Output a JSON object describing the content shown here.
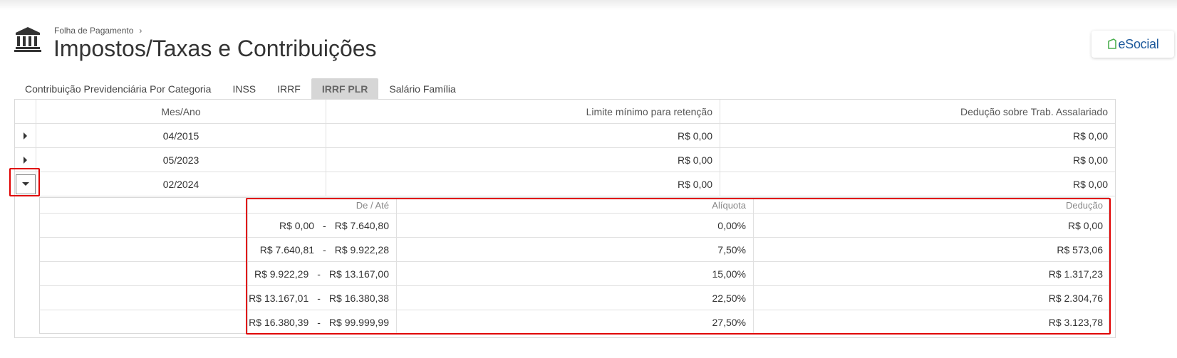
{
  "header": {
    "breadcrumb": "Folha de Pagamento",
    "title": "Impostos/Taxas e Contribuições",
    "esocial_label": "eSocial"
  },
  "colors": {
    "highlight": "#e00000",
    "esocial_blue": "#1e5a9c",
    "esocial_green": "#4caf50"
  },
  "tabs": [
    {
      "label": "Contribuição Previdenciária Por Categoria",
      "active": false
    },
    {
      "label": "INSS",
      "active": false
    },
    {
      "label": "IRRF",
      "active": false
    },
    {
      "label": "IRRF PLR",
      "active": true
    },
    {
      "label": "Salário Família",
      "active": false
    }
  ],
  "grid": {
    "columns": [
      "Mes/Ano",
      "Limite mínimo para retenção",
      "Dedução sobre Trab. Assalariado"
    ],
    "rows": [
      {
        "mes": "04/2015",
        "limite": "R$ 0,00",
        "deducao": "R$ 0,00",
        "expanded": false
      },
      {
        "mes": "05/2023",
        "limite": "R$ 0,00",
        "deducao": "R$ 0,00",
        "expanded": false
      },
      {
        "mes": "02/2024",
        "limite": "R$ 0,00",
        "deducao": "R$ 0,00",
        "expanded": true
      }
    ]
  },
  "detail": {
    "columns": [
      "De / Até",
      "Alíquota",
      "Dedução"
    ],
    "separator": "-",
    "rows": [
      {
        "de": "R$ 0,00",
        "ate": "R$ 7.640,80",
        "aliquota": "0,00%",
        "deducao": "R$ 0,00"
      },
      {
        "de": "R$ 7.640,81",
        "ate": "R$ 9.922,28",
        "aliquota": "7,50%",
        "deducao": "R$ 573,06"
      },
      {
        "de": "R$ 9.922,29",
        "ate": "R$ 13.167,00",
        "aliquota": "15,00%",
        "deducao": "R$ 1.317,23"
      },
      {
        "de": "R$ 13.167,01",
        "ate": "R$ 16.380,38",
        "aliquota": "22,50%",
        "deducao": "R$ 2.304,76"
      },
      {
        "de": "R$ 16.380,39",
        "ate": "R$ 99.999,99",
        "aliquota": "27,50%",
        "deducao": "R$ 3.123,78"
      }
    ]
  }
}
